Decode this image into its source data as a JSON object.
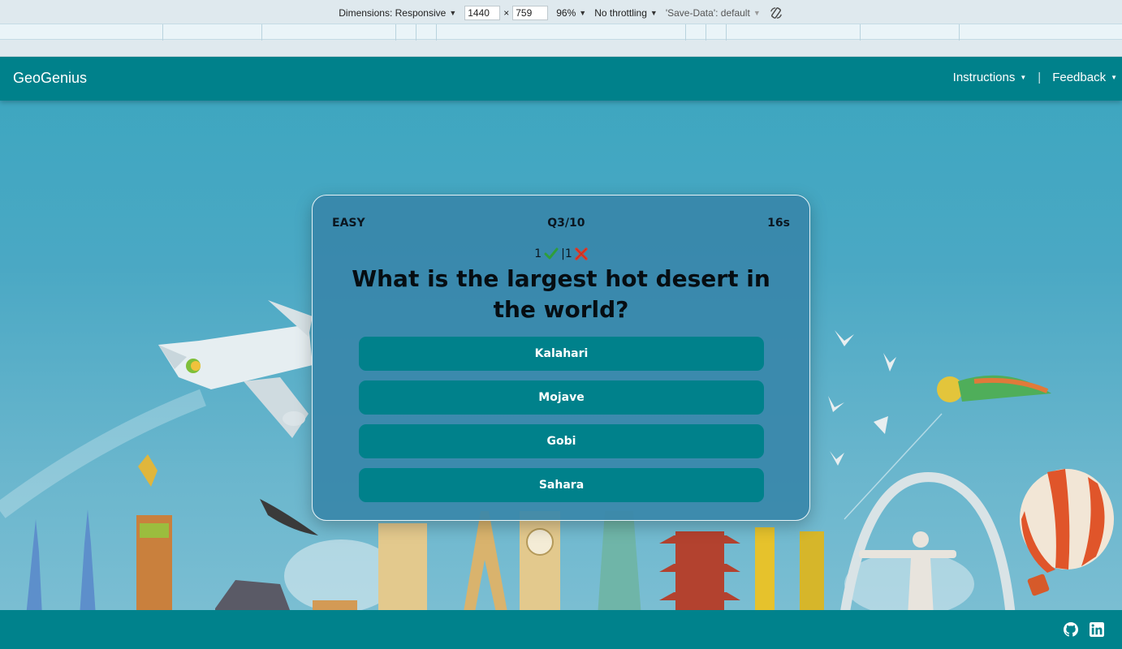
{
  "devtools": {
    "dimensions_label": "Dimensions: Responsive",
    "width_value": "1440",
    "times_sign": "×",
    "height_value": "759",
    "zoom_label": "96%",
    "throttling_label": "No throttling",
    "save_data_label": "'Save-Data': default",
    "rotate_icon": "rotate-icon"
  },
  "navbar": {
    "brand": "GeoGenius",
    "instructions_label": "Instructions",
    "separator": "|",
    "feedback_label": "Feedback"
  },
  "quiz": {
    "difficulty": "EASY",
    "question_counter": "Q3/10",
    "timer": "16s",
    "correct_count": "1",
    "score_separator": "|1",
    "question": "What is the largest hot desert in the world?",
    "answers": [
      "Kalahari",
      "Mojave",
      "Gobi",
      "Sahara"
    ]
  },
  "footer": {
    "icons": [
      "github-icon",
      "linkedin-icon"
    ]
  },
  "colors": {
    "navbar": "#00818b",
    "answer_button": "#00818b",
    "card": "#3887aa",
    "sky": "#4aa8c4"
  }
}
